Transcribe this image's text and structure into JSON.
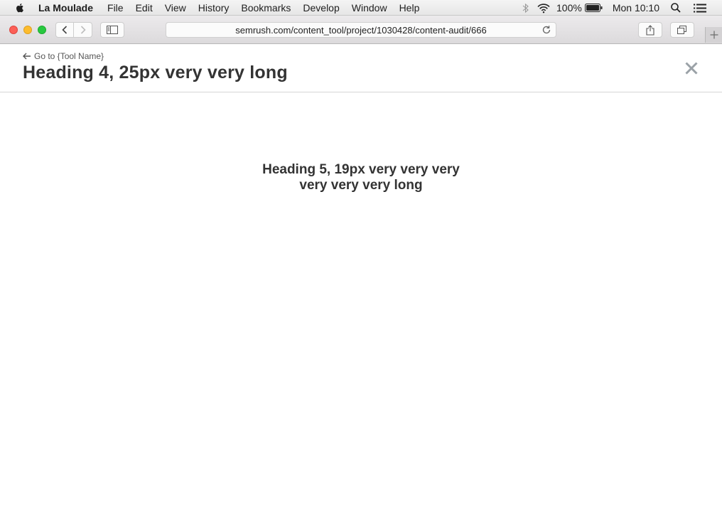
{
  "menubar": {
    "app_name": "La Moulade",
    "items": [
      "File",
      "Edit",
      "View",
      "History",
      "Bookmarks",
      "Develop",
      "Window",
      "Help"
    ],
    "battery": "100%",
    "clock": "Mon 10:10"
  },
  "browser": {
    "url": "semrush.com/content_tool/project/1030428/content-audit/666"
  },
  "page": {
    "back_link": "Go to {Tool Name}",
    "title": "Heading 4, 25px very very long",
    "heading": "Heading 5, 19px very very very very very very long"
  }
}
